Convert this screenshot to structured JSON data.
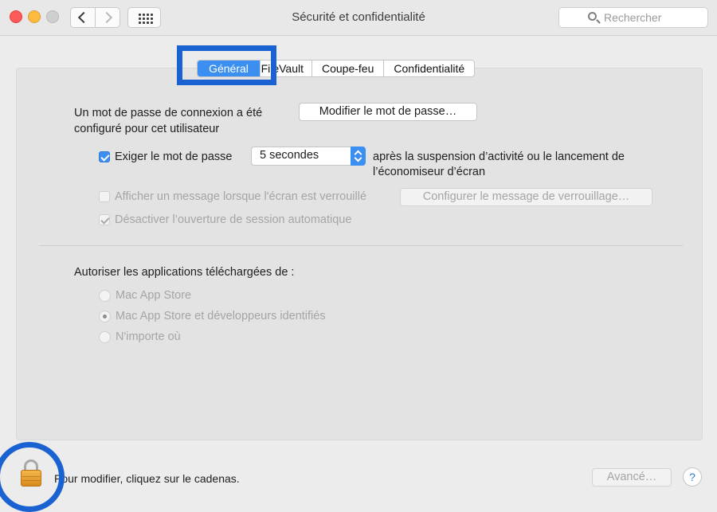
{
  "window": {
    "title": "Sécurité et confidentialité",
    "search_placeholder": "Rechercher"
  },
  "tabs": [
    {
      "label": "Général",
      "active": true
    },
    {
      "label": "FileVault",
      "active": false
    },
    {
      "label": "Coupe-feu",
      "active": false
    },
    {
      "label": "Confidentialité",
      "active": false
    }
  ],
  "general": {
    "password_text_line1": "Un mot de passe de connexion a été",
    "password_text_line2": "configuré pour cet utilisateur",
    "change_password_button": "Modifier le mot de passe…",
    "require_password_label": "Exiger le mot de passe",
    "require_password_checked": true,
    "delay_value": "5 secondes",
    "after_text_line1": "après la suspension d’activité ou le lancement de",
    "after_text_line2": "l’économiseur d’écran",
    "show_message_label": "Afficher un message lorsque l'écran est verrouillé",
    "show_message_checked": false,
    "configure_message_button": "Configurer le message de verrouillage…",
    "disable_autologin_label": "Désactiver l’ouverture de session automatique",
    "disable_autologin_checked": true,
    "apps_heading": "Autoriser les applications téléchargées de :",
    "radio_options": [
      {
        "label": "Mac App Store",
        "selected": false
      },
      {
        "label": "Mac App Store et développeurs identifiés",
        "selected": true
      },
      {
        "label": "N'importe où",
        "selected": false
      }
    ]
  },
  "footer": {
    "lock_text": "Pour modifier, cliquez sur le cadenas.",
    "advanced_button": "Avancé…",
    "help_button": "?"
  },
  "colors": {
    "accent": "#3b8ff0",
    "highlight_annotation": "#1a62d2"
  }
}
